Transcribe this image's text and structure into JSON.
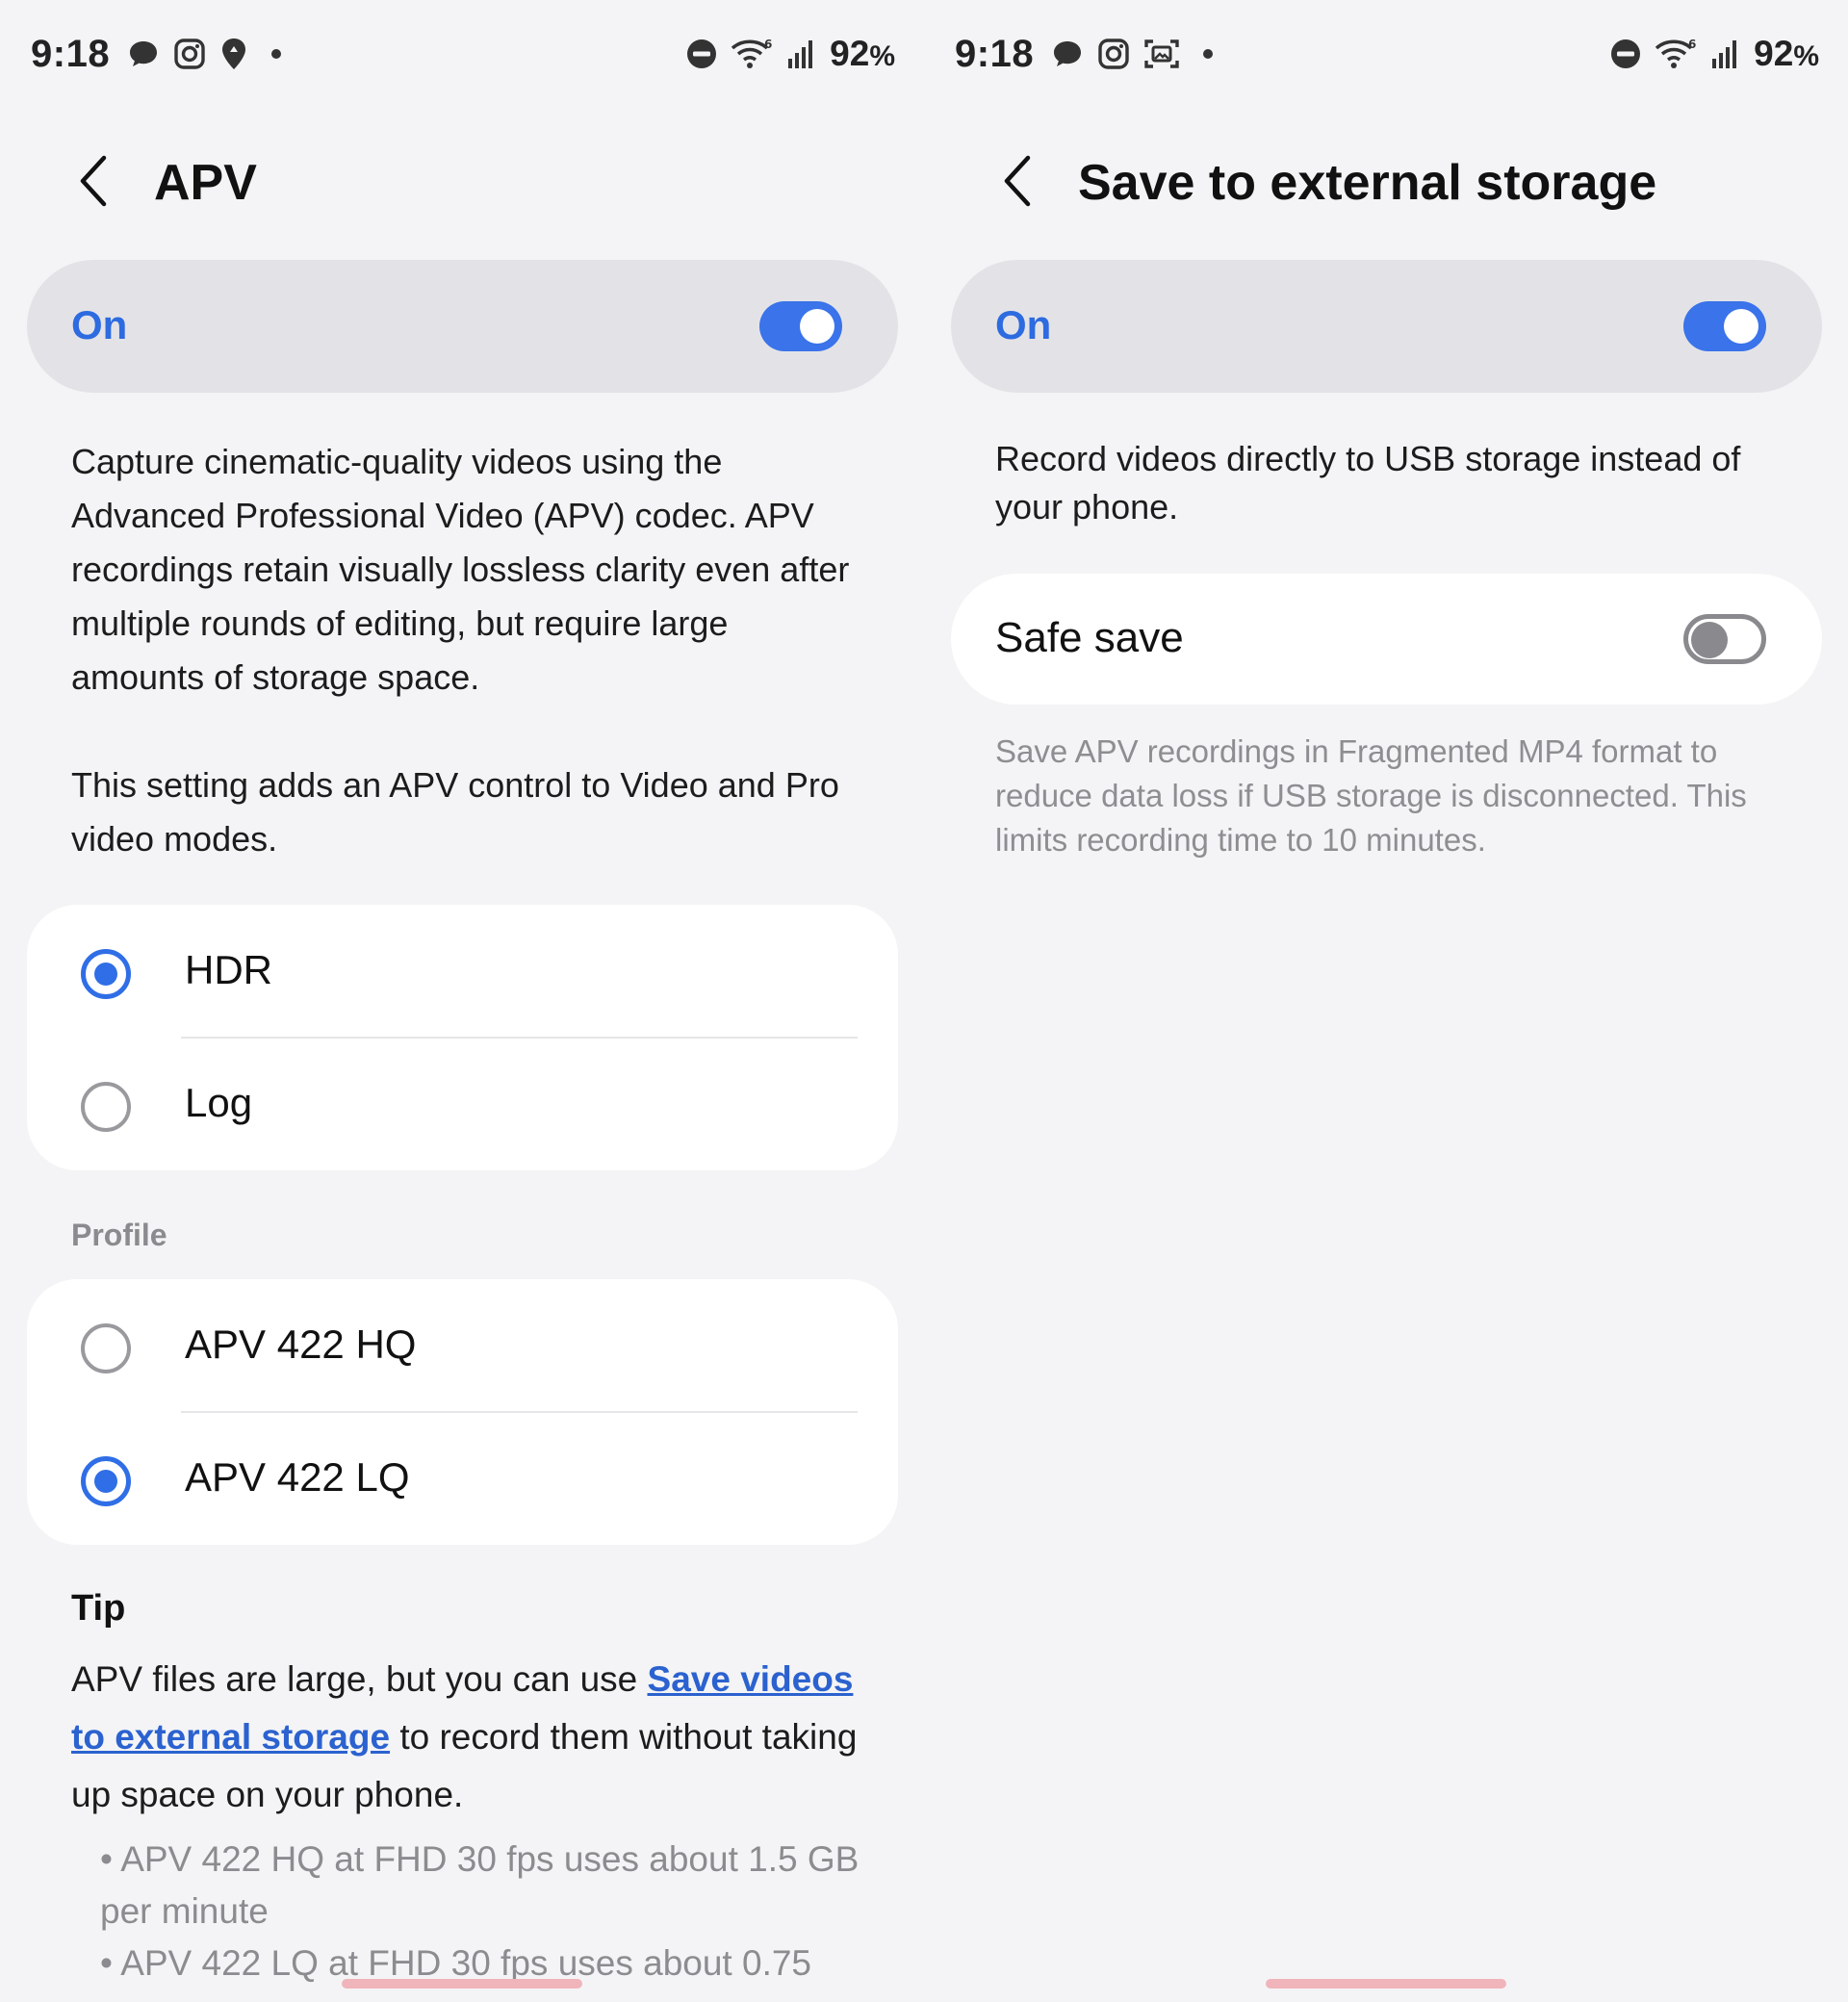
{
  "statusbar": {
    "time": "9:18",
    "battery": "92",
    "battery_unit": "%"
  },
  "apv": {
    "title": "APV",
    "master": {
      "label": "On",
      "state": "on"
    },
    "desc1": "Capture cinematic-quality videos using the Advanced Professional Video (APV) codec. APV recordings retain visually lossless clarity even after multiple rounds of editing, but require large amounts of storage space.",
    "desc2": "This setting adds an APV control to Video and Pro video modes.",
    "modes": [
      {
        "label": "HDR",
        "checked": true
      },
      {
        "label": "Log",
        "checked": false
      }
    ],
    "profile_label": "Profile",
    "profiles": [
      {
        "label": "APV 422 HQ",
        "checked": false
      },
      {
        "label": "APV 422 LQ",
        "checked": true
      }
    ],
    "tip": {
      "title": "Tip",
      "text_before": "APV files are large, but you can use ",
      "link": "Save videos to external storage",
      "text_after": " to record them without taking up space on your phone.",
      "bullets": [
        "• APV 422 HQ at FHD 30 fps uses about 1.5 GB per minute",
        "• APV 422 LQ at FHD 30 fps uses about 0.75"
      ]
    }
  },
  "external": {
    "title": "Save to external storage",
    "master": {
      "label": "On",
      "state": "on"
    },
    "desc": "Record videos directly to USB storage instead of your phone.",
    "safe_save": {
      "label": "Safe save",
      "state": "off"
    },
    "note": "Save APV recordings in Fragmented MP4 format to reduce data loss if USB storage is disconnected. This limits recording time to 10 minutes."
  },
  "icons": {
    "status_left_a": [
      "chat-bubble-icon",
      "instagram-icon",
      "location-pin-icon",
      "dot-icon"
    ],
    "status_left_b": [
      "chat-bubble-icon",
      "instagram-icon",
      "screenshot-icon",
      "dot-icon"
    ],
    "status_right": [
      "do-not-disturb-icon",
      "wifi-6-icon",
      "signal-icon"
    ],
    "back": "chevron-left-icon"
  },
  "colors": {
    "accent": "#3a73ea",
    "link": "#2b62cf",
    "background": "#f4f4f6",
    "master_bg": "#e3e3e7",
    "secondary_text": "#8b8b8f"
  }
}
